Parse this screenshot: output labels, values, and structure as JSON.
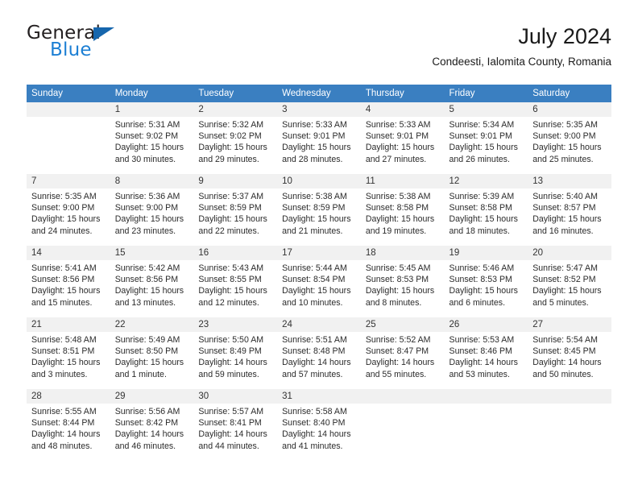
{
  "brand": {
    "name_part1": "General",
    "name_part2": "Blue",
    "logo_icon": "triangle-flag-icon"
  },
  "header": {
    "title": "July 2024",
    "subtitle": "Condeesti, Ialomita County, Romania"
  },
  "calendar": {
    "weekday_headers": [
      "Sunday",
      "Monday",
      "Tuesday",
      "Wednesday",
      "Thursday",
      "Friday",
      "Saturday"
    ],
    "accent_color": "#3a7fc1",
    "separator_color": "#2f6fae",
    "daynum_band_color": "#f1f1f1",
    "weeks": [
      [
        {
          "day": "",
          "sunrise": "",
          "sunset": "",
          "daylight1": "",
          "daylight2": ""
        },
        {
          "day": "1",
          "sunrise": "Sunrise: 5:31 AM",
          "sunset": "Sunset: 9:02 PM",
          "daylight1": "Daylight: 15 hours",
          "daylight2": "and 30 minutes."
        },
        {
          "day": "2",
          "sunrise": "Sunrise: 5:32 AM",
          "sunset": "Sunset: 9:02 PM",
          "daylight1": "Daylight: 15 hours",
          "daylight2": "and 29 minutes."
        },
        {
          "day": "3",
          "sunrise": "Sunrise: 5:33 AM",
          "sunset": "Sunset: 9:01 PM",
          "daylight1": "Daylight: 15 hours",
          "daylight2": "and 28 minutes."
        },
        {
          "day": "4",
          "sunrise": "Sunrise: 5:33 AM",
          "sunset": "Sunset: 9:01 PM",
          "daylight1": "Daylight: 15 hours",
          "daylight2": "and 27 minutes."
        },
        {
          "day": "5",
          "sunrise": "Sunrise: 5:34 AM",
          "sunset": "Sunset: 9:01 PM",
          "daylight1": "Daylight: 15 hours",
          "daylight2": "and 26 minutes."
        },
        {
          "day": "6",
          "sunrise": "Sunrise: 5:35 AM",
          "sunset": "Sunset: 9:00 PM",
          "daylight1": "Daylight: 15 hours",
          "daylight2": "and 25 minutes."
        }
      ],
      [
        {
          "day": "7",
          "sunrise": "Sunrise: 5:35 AM",
          "sunset": "Sunset: 9:00 PM",
          "daylight1": "Daylight: 15 hours",
          "daylight2": "and 24 minutes."
        },
        {
          "day": "8",
          "sunrise": "Sunrise: 5:36 AM",
          "sunset": "Sunset: 9:00 PM",
          "daylight1": "Daylight: 15 hours",
          "daylight2": "and 23 minutes."
        },
        {
          "day": "9",
          "sunrise": "Sunrise: 5:37 AM",
          "sunset": "Sunset: 8:59 PM",
          "daylight1": "Daylight: 15 hours",
          "daylight2": "and 22 minutes."
        },
        {
          "day": "10",
          "sunrise": "Sunrise: 5:38 AM",
          "sunset": "Sunset: 8:59 PM",
          "daylight1": "Daylight: 15 hours",
          "daylight2": "and 21 minutes."
        },
        {
          "day": "11",
          "sunrise": "Sunrise: 5:38 AM",
          "sunset": "Sunset: 8:58 PM",
          "daylight1": "Daylight: 15 hours",
          "daylight2": "and 19 minutes."
        },
        {
          "day": "12",
          "sunrise": "Sunrise: 5:39 AM",
          "sunset": "Sunset: 8:58 PM",
          "daylight1": "Daylight: 15 hours",
          "daylight2": "and 18 minutes."
        },
        {
          "day": "13",
          "sunrise": "Sunrise: 5:40 AM",
          "sunset": "Sunset: 8:57 PM",
          "daylight1": "Daylight: 15 hours",
          "daylight2": "and 16 minutes."
        }
      ],
      [
        {
          "day": "14",
          "sunrise": "Sunrise: 5:41 AM",
          "sunset": "Sunset: 8:56 PM",
          "daylight1": "Daylight: 15 hours",
          "daylight2": "and 15 minutes."
        },
        {
          "day": "15",
          "sunrise": "Sunrise: 5:42 AM",
          "sunset": "Sunset: 8:56 PM",
          "daylight1": "Daylight: 15 hours",
          "daylight2": "and 13 minutes."
        },
        {
          "day": "16",
          "sunrise": "Sunrise: 5:43 AM",
          "sunset": "Sunset: 8:55 PM",
          "daylight1": "Daylight: 15 hours",
          "daylight2": "and 12 minutes."
        },
        {
          "day": "17",
          "sunrise": "Sunrise: 5:44 AM",
          "sunset": "Sunset: 8:54 PM",
          "daylight1": "Daylight: 15 hours",
          "daylight2": "and 10 minutes."
        },
        {
          "day": "18",
          "sunrise": "Sunrise: 5:45 AM",
          "sunset": "Sunset: 8:53 PM",
          "daylight1": "Daylight: 15 hours",
          "daylight2": "and 8 minutes."
        },
        {
          "day": "19",
          "sunrise": "Sunrise: 5:46 AM",
          "sunset": "Sunset: 8:53 PM",
          "daylight1": "Daylight: 15 hours",
          "daylight2": "and 6 minutes."
        },
        {
          "day": "20",
          "sunrise": "Sunrise: 5:47 AM",
          "sunset": "Sunset: 8:52 PM",
          "daylight1": "Daylight: 15 hours",
          "daylight2": "and 5 minutes."
        }
      ],
      [
        {
          "day": "21",
          "sunrise": "Sunrise: 5:48 AM",
          "sunset": "Sunset: 8:51 PM",
          "daylight1": "Daylight: 15 hours",
          "daylight2": "and 3 minutes."
        },
        {
          "day": "22",
          "sunrise": "Sunrise: 5:49 AM",
          "sunset": "Sunset: 8:50 PM",
          "daylight1": "Daylight: 15 hours",
          "daylight2": "and 1 minute."
        },
        {
          "day": "23",
          "sunrise": "Sunrise: 5:50 AM",
          "sunset": "Sunset: 8:49 PM",
          "daylight1": "Daylight: 14 hours",
          "daylight2": "and 59 minutes."
        },
        {
          "day": "24",
          "sunrise": "Sunrise: 5:51 AM",
          "sunset": "Sunset: 8:48 PM",
          "daylight1": "Daylight: 14 hours",
          "daylight2": "and 57 minutes."
        },
        {
          "day": "25",
          "sunrise": "Sunrise: 5:52 AM",
          "sunset": "Sunset: 8:47 PM",
          "daylight1": "Daylight: 14 hours",
          "daylight2": "and 55 minutes."
        },
        {
          "day": "26",
          "sunrise": "Sunrise: 5:53 AM",
          "sunset": "Sunset: 8:46 PM",
          "daylight1": "Daylight: 14 hours",
          "daylight2": "and 53 minutes."
        },
        {
          "day": "27",
          "sunrise": "Sunrise: 5:54 AM",
          "sunset": "Sunset: 8:45 PM",
          "daylight1": "Daylight: 14 hours",
          "daylight2": "and 50 minutes."
        }
      ],
      [
        {
          "day": "28",
          "sunrise": "Sunrise: 5:55 AM",
          "sunset": "Sunset: 8:44 PM",
          "daylight1": "Daylight: 14 hours",
          "daylight2": "and 48 minutes."
        },
        {
          "day": "29",
          "sunrise": "Sunrise: 5:56 AM",
          "sunset": "Sunset: 8:42 PM",
          "daylight1": "Daylight: 14 hours",
          "daylight2": "and 46 minutes."
        },
        {
          "day": "30",
          "sunrise": "Sunrise: 5:57 AM",
          "sunset": "Sunset: 8:41 PM",
          "daylight1": "Daylight: 14 hours",
          "daylight2": "and 44 minutes."
        },
        {
          "day": "31",
          "sunrise": "Sunrise: 5:58 AM",
          "sunset": "Sunset: 8:40 PM",
          "daylight1": "Daylight: 14 hours",
          "daylight2": "and 41 minutes."
        },
        {
          "day": "",
          "sunrise": "",
          "sunset": "",
          "daylight1": "",
          "daylight2": ""
        },
        {
          "day": "",
          "sunrise": "",
          "sunset": "",
          "daylight1": "",
          "daylight2": ""
        },
        {
          "day": "",
          "sunrise": "",
          "sunset": "",
          "daylight1": "",
          "daylight2": ""
        }
      ]
    ]
  }
}
